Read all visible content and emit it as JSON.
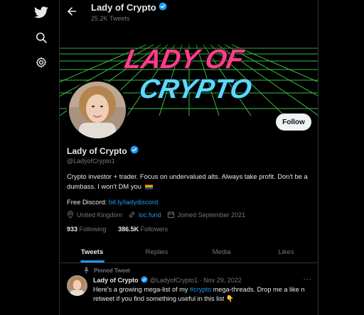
{
  "nav": {
    "icons": [
      "twitter-bird-icon",
      "search-icon",
      "settings-gear-icon"
    ]
  },
  "header": {
    "title": "Lady of Crypto",
    "tweet_count": "25.2K Tweets"
  },
  "banner": {
    "line1": "LADY OF",
    "line2": "CRYPTO"
  },
  "profile": {
    "name": "Lady of Crypto",
    "handle": "@LadyofCrypto1",
    "bio": "Crypto investor + trader. Focus on undervalued alts. Always take profit. Don't be a dumbass. I won't DM you",
    "discord_label": "Free Discord: ",
    "discord_link": "bit.ly/ladydiscord",
    "location": "United Kingdom",
    "website": "loc.fund",
    "joined": "Joined September 2021",
    "following_count": "933",
    "following_label": "Following",
    "followers_count": "386.5K",
    "followers_label": "Followers",
    "follow_button": "Follow"
  },
  "tabs": [
    "Tweets",
    "Replies",
    "Media",
    "Likes"
  ],
  "pinned_tweet": {
    "pinned_label": "Pinned Tweet",
    "author": "Lady of Crypto",
    "handle_date": "@LadyofCrypto1 · Nov 29, 2022",
    "more": "···",
    "text_before": "Here's a growing mega-list of my ",
    "hashtag": "#crypto",
    "text_after": " mega-threads. Drop me a like n retweet if you find something useful in this list 👇"
  },
  "colors": {
    "accent": "#1d9bf0",
    "banner_pink": "#ff3d8b",
    "banner_cyan": "#5ed7ff",
    "grid_green": "#3fd24a"
  }
}
